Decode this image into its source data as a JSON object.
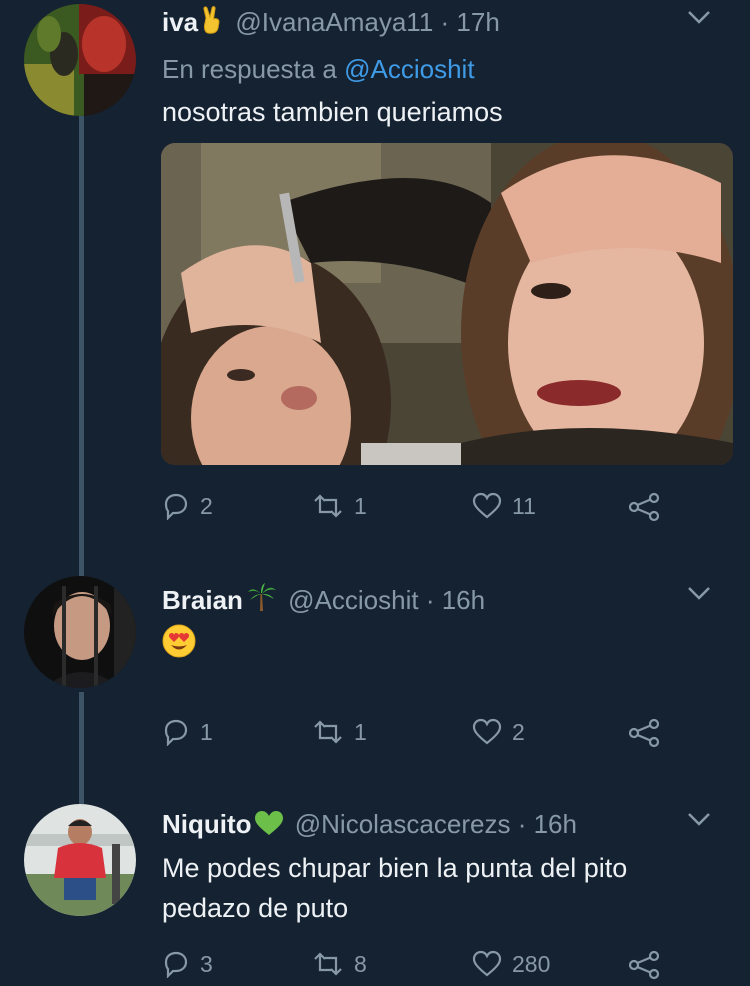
{
  "tweets": [
    {
      "name": "iva",
      "handle": "@IvanaAmaya11",
      "time": "· 17h",
      "reply_prefix": "En respuesta a",
      "reply_mention": "@Accioshit",
      "text": "nosotras tambien queriamos",
      "replies": "2",
      "retweets": "1",
      "likes": "11",
      "name_emoji": "victory-hand"
    },
    {
      "name": "Braian",
      "handle": "@Accioshit",
      "time": "· 16h",
      "text_emoji": "heart-eyes-face",
      "replies": "1",
      "retweets": "1",
      "likes": "2",
      "name_emoji": "palm-tree"
    },
    {
      "name": "Niquito",
      "handle": "@Nicolascacerezs",
      "time": "· 16h",
      "text_line1": "Me podes chupar bien la punta del pito",
      "text_line2": "pedazo de puto",
      "replies": "3",
      "retweets": "8",
      "likes": "280",
      "name_emoji": "green-heart"
    }
  ],
  "colors": {
    "background": "#152232",
    "text": "#eef2f5",
    "secondary": "#8899a6",
    "link": "#3f9be6",
    "thread": "#3d5366"
  }
}
